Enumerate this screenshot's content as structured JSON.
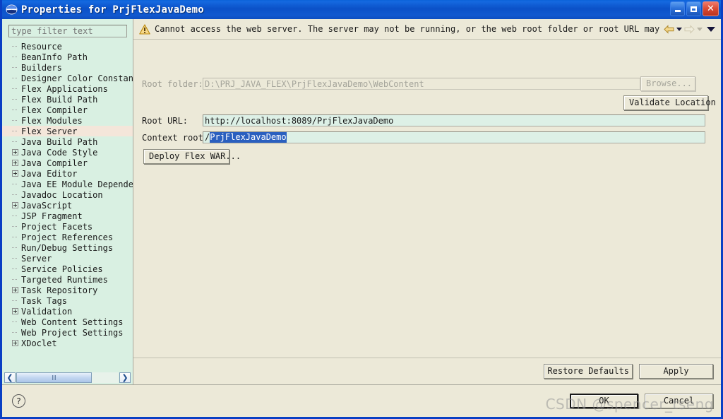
{
  "window": {
    "title": "Properties for PrjFlexJavaDemo",
    "icon": "globe-icon",
    "minimize_label": "Minimize",
    "maximize_label": "Restore",
    "close_label": "Close"
  },
  "sidebar": {
    "filter_placeholder": "type filter text",
    "filter_value": "",
    "scroll_left_label": "❮",
    "scroll_right_label": "❯",
    "items": [
      {
        "label": "Resource",
        "expandable": false,
        "selected": false
      },
      {
        "label": "BeanInfo Path",
        "expandable": false,
        "selected": false
      },
      {
        "label": "Builders",
        "expandable": false,
        "selected": false
      },
      {
        "label": "Designer Color Constants",
        "expandable": false,
        "selected": false
      },
      {
        "label": "Flex Applications",
        "expandable": false,
        "selected": false
      },
      {
        "label": "Flex Build Path",
        "expandable": false,
        "selected": false
      },
      {
        "label": "Flex Compiler",
        "expandable": false,
        "selected": false
      },
      {
        "label": "Flex Modules",
        "expandable": false,
        "selected": false
      },
      {
        "label": "Flex Server",
        "expandable": false,
        "selected": true
      },
      {
        "label": "Java Build Path",
        "expandable": false,
        "selected": false
      },
      {
        "label": "Java Code Style",
        "expandable": true,
        "selected": false
      },
      {
        "label": "Java Compiler",
        "expandable": true,
        "selected": false
      },
      {
        "label": "Java Editor",
        "expandable": true,
        "selected": false
      },
      {
        "label": "Java EE Module Dependencies",
        "expandable": false,
        "selected": false
      },
      {
        "label": "Javadoc Location",
        "expandable": false,
        "selected": false
      },
      {
        "label": "JavaScript",
        "expandable": true,
        "selected": false
      },
      {
        "label": "JSP Fragment",
        "expandable": false,
        "selected": false
      },
      {
        "label": "Project Facets",
        "expandable": false,
        "selected": false
      },
      {
        "label": "Project References",
        "expandable": false,
        "selected": false
      },
      {
        "label": "Run/Debug Settings",
        "expandable": false,
        "selected": false
      },
      {
        "label": "Server",
        "expandable": false,
        "selected": false
      },
      {
        "label": "Service Policies",
        "expandable": false,
        "selected": false
      },
      {
        "label": "Targeted Runtimes",
        "expandable": false,
        "selected": false
      },
      {
        "label": "Task Repository",
        "expandable": true,
        "selected": false
      },
      {
        "label": "Task Tags",
        "expandable": false,
        "selected": false
      },
      {
        "label": "Validation",
        "expandable": true,
        "selected": false
      },
      {
        "label": "Web Content Settings",
        "expandable": false,
        "selected": false
      },
      {
        "label": "Web Project Settings",
        "expandable": false,
        "selected": false
      },
      {
        "label": "XDoclet",
        "expandable": true,
        "selected": false
      }
    ]
  },
  "message": {
    "icon": "warning-icon",
    "text": "Cannot access the web server. The server may not be running, or the web root folder or root URL may be invalid."
  },
  "nav": {
    "back_label": "Back",
    "back_menu_label": "Back history",
    "forward_label": "Forward",
    "forward_menu_label": "Forward history",
    "menu_label": "View Menu"
  },
  "form": {
    "root_folder": {
      "label": "Root folder:",
      "value": "D:\\PRJ_JAVA_FLEX\\PrjFlexJavaDemo\\WebContent",
      "disabled": true
    },
    "browse_button": {
      "label": "Browse...",
      "disabled": true
    },
    "validate_button": {
      "label": "Validate Location",
      "disabled": false
    },
    "root_url": {
      "label": "Root URL:",
      "value": "http://localhost:8089/PrjFlexJavaDemo"
    },
    "context_root": {
      "label": "Context root:",
      "value_prefix": "/",
      "value_selected": "PrjFlexJavaDemo"
    },
    "deploy_button": {
      "label": "Deploy Flex WAR..."
    }
  },
  "actions": {
    "restore_defaults": "Restore Defaults",
    "apply": "Apply",
    "ok": "OK",
    "cancel": "Cancel",
    "help": "?"
  },
  "watermark": "CSDN @spencer_tseng",
  "colors": {
    "title_bar": "#0b51c8",
    "tree_background": "#d9f0e2",
    "panel_background": "#ece9d8",
    "field_background": "#ddf0e6",
    "selection": "#2a5fbf",
    "warning": "#e8a317",
    "close_button": "#d94a33"
  }
}
